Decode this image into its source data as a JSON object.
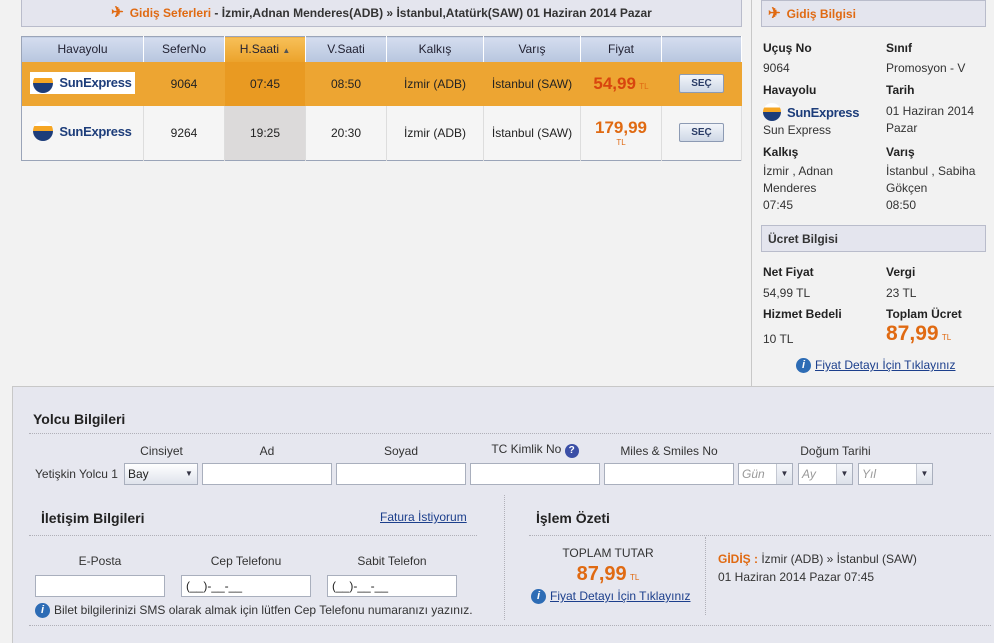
{
  "header": {
    "title": "Gidiş Seferleri",
    "route": " - İzmir,Adnan Menderes(ADB) » İstanbul,Atatürk(SAW) 01 Haziran 2014 Pazar"
  },
  "table": {
    "columns": [
      "Havayolu",
      "SeferNo",
      "H.Saati",
      "V.Saati",
      "Kalkış",
      "Varış",
      "Fiyat",
      ""
    ],
    "sort_indicator": "▲",
    "rows": [
      {
        "airline": "SunExpress",
        "flight_no": "9064",
        "dep": "07:45",
        "arr": "08:50",
        "from": "İzmir (ADB)",
        "to": "İstanbul (SAW)",
        "price": "54,99",
        "currency": "TL",
        "button": "SEÇ",
        "selected": true
      },
      {
        "airline": "SunExpress",
        "flight_no": "9264",
        "dep": "19:25",
        "arr": "20:30",
        "from": "İzmir (ADB)",
        "to": "İstanbul (SAW)",
        "price": "179,99",
        "currency": "TL",
        "button": "SEÇ",
        "selected": false
      }
    ]
  },
  "side": {
    "title": "Gidiş Bilgisi",
    "flight_no_label": "Uçuş No",
    "flight_no": "9064",
    "class_label": "Sınıf",
    "class": "Promosyon - V",
    "airline_label": "Havayolu",
    "airline_logo": "SunExpress",
    "airline": "Sun Express",
    "date_label": "Tarih",
    "date1": "01 Haziran 2014",
    "date2": "Pazar",
    "dep_label": "Kalkış",
    "dep1": "İzmir , Adnan",
    "dep2": "Menderes",
    "dep_time": "07:45",
    "arr_label": "Varış",
    "arr1": "İstanbul , Sabiha",
    "arr2": "Gökçen",
    "arr_time": "08:50",
    "fare_title": "Ücret Bilgisi",
    "net_label": "Net Fiyat",
    "net": "54,99 TL",
    "tax_label": "Vergi",
    "tax": "23 TL",
    "service_label": "Hizmet Bedeli",
    "service": "10 TL",
    "total_label": "Toplam Ücret",
    "total": "87,99",
    "currency": "TL",
    "detail_link": "Fiyat Detayı İçin Tıklayınız"
  },
  "passenger": {
    "title": "Yolcu Bilgileri",
    "row_label": "Yetişkin Yolcu 1",
    "labels": {
      "gender": "Cinsiyet",
      "name": "Ad",
      "surname": "Soyad",
      "tc": "TC Kimlik No",
      "miles": "Miles & Smiles No",
      "birth": "Doğum Tarihi"
    },
    "gender_value": "Bay",
    "day_placeholder": "Gün",
    "month_placeholder": "Ay",
    "year_placeholder": "Yıl",
    "help_icon": "?"
  },
  "contact": {
    "title": "İletişim Bilgileri",
    "invoice_link": "Fatura İstiyorum",
    "email_label": "E-Posta",
    "mobile_label": "Cep Telefonu",
    "phone_label": "Sabit Telefon",
    "mobile_mask": "(__)-__-__",
    "phone_mask": "(__)-__-__",
    "note": "Bilet bilgilerinizi SMS olarak almak için lütfen Cep Telefonu numaranızı yazınız."
  },
  "summary": {
    "title": "İşlem Özeti",
    "total_label": "TOPLAM TUTAR",
    "total": "87,99",
    "currency": "TL",
    "detail_link": "Fiyat Detayı İçin Tıklayınız",
    "leg_label": "GİDİŞ :",
    "leg_route": " İzmir (ADB) » İstanbul (SAW)",
    "leg_date": "01 Haziran 2014 Pazar 07:45"
  },
  "colors": {
    "accent": "#e06a12",
    "selected_row": "#eda532",
    "header_blue": "#c5d1e6"
  }
}
